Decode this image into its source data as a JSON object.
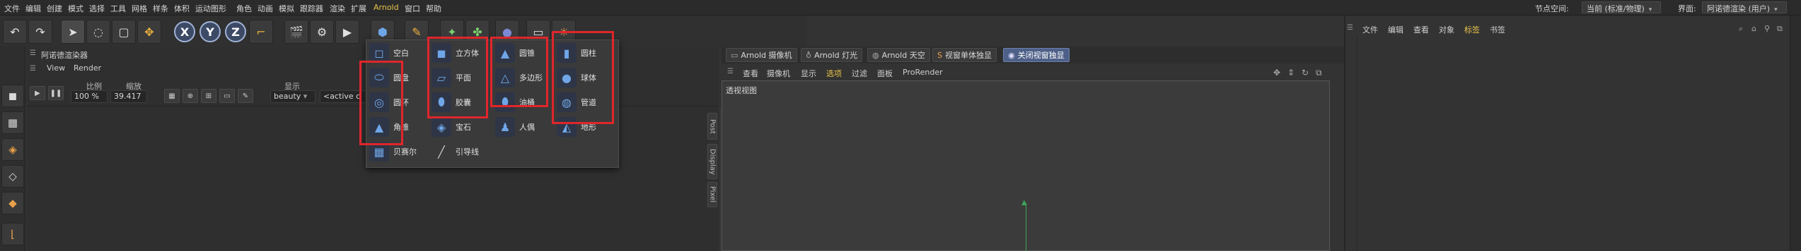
{
  "menubar": {
    "items": [
      "文件",
      "编辑",
      "创建",
      "模式",
      "选择",
      "工具",
      "网格",
      "样条",
      "体积",
      "运动图形",
      "角色",
      "动画",
      "模拟",
      "跟踪器",
      "渲染",
      "扩展",
      "Arnold",
      "窗口",
      "帮助"
    ],
    "node_space_label": "节点空间:",
    "node_space_value": "当前 (标准/物理)",
    "interface_label": "界面:",
    "interface_value": "阿诺德渲染 (用户)"
  },
  "toolbar": {
    "axis_x": "X",
    "axis_y": "Y",
    "axis_z": "Z",
    "icons": [
      "undo-icon",
      "redo-icon",
      "select-arrow-icon",
      "move-icon",
      "scale-icon",
      "rotate-icon",
      "clapper-icon",
      "render-icon",
      "cube-icon"
    ]
  },
  "renderer": {
    "title": "阿诺德渲染器",
    "menu": [
      "View",
      "Render"
    ],
    "ratio_label": "比例",
    "zoom_label": "缩放",
    "display_label": "显示",
    "ratio_value": "100 %",
    "zoom_value": "39.417",
    "display_value": "beauty",
    "camera_value": "<active c",
    "side_tabs": [
      "Post",
      "Display",
      "Pixel"
    ]
  },
  "popup": {
    "col1": [
      "空白",
      "圆盘",
      "圆环",
      "角锥",
      "贝赛尔"
    ],
    "col2": [
      "立方体",
      "平面",
      "胶囊",
      "宝石",
      "引导线"
    ],
    "col3": [
      "圆锥",
      "多边形",
      "油桶",
      "人偶"
    ],
    "col4": [
      "圆柱",
      "球体",
      "管道",
      "地形"
    ]
  },
  "viewport": {
    "tabs": [
      "Arnold 摄像机",
      "Arnold 灯光",
      "Arnold 天空",
      "视窗单体独显",
      "关闭视窗独显"
    ],
    "menu": [
      "查看",
      "摄像机",
      "显示",
      "选项",
      "过滤",
      "面板",
      "ProRender"
    ],
    "label": "透视视图"
  },
  "object_manager": {
    "menu": [
      "文件",
      "编辑",
      "查看",
      "对象",
      "标签",
      "书签"
    ]
  },
  "colors": {
    "highlight_box": "#e0262b",
    "active_tab": "#4e6088",
    "menu_accent": "#e7c34a"
  }
}
